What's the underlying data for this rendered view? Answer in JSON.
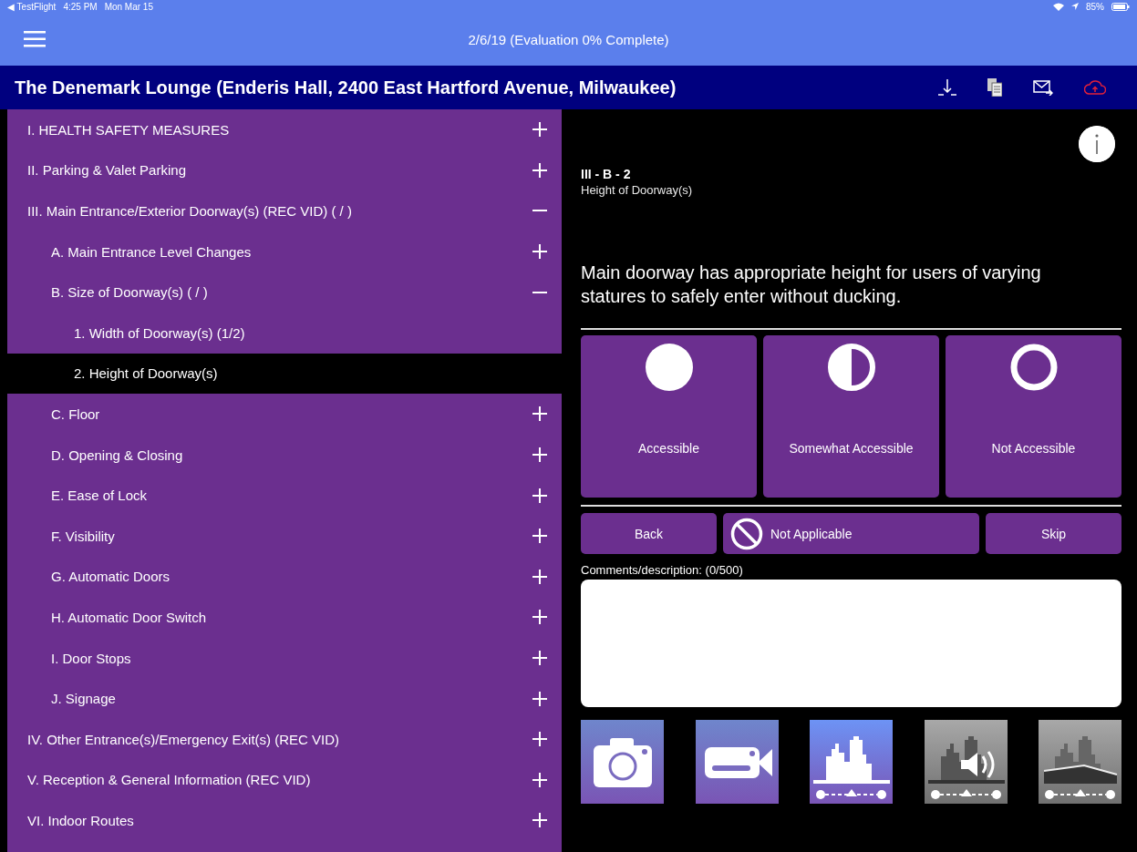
{
  "status_bar": {
    "back_app": "◀ TestFlight",
    "time": "4:25 PM",
    "date": "Mon Mar 15",
    "battery": "85%"
  },
  "nav_bar": {
    "title": "2/6/19 (Evaluation 0% Complete)"
  },
  "header": {
    "title": "The Denemark Lounge (Enderis Hall, 2400 East Hartford Avenue, Milwaukee)"
  },
  "sidebar": {
    "items": [
      {
        "label": "I. HEALTH SAFETY MEASURES",
        "expanded": false,
        "selected": false
      },
      {
        "label": "II. Parking & Valet Parking",
        "expanded": false,
        "selected": false
      },
      {
        "label": "III. Main Entrance/Exterior Doorway(s) (REC VID) ( / )",
        "expanded": true,
        "selected": false,
        "children": [
          {
            "label": "A. Main Entrance Level Changes",
            "expanded": false,
            "selected": false
          },
          {
            "label": "B. Size of Doorway(s) ( / )",
            "expanded": true,
            "selected": false,
            "children": [
              {
                "label": "1. Width of Doorway(s) (1/2)",
                "selected": false
              },
              {
                "label": "2. Height of Doorway(s)",
                "selected": true
              }
            ]
          },
          {
            "label": "C. Floor",
            "expanded": false,
            "selected": false
          },
          {
            "label": "D. Opening & Closing",
            "expanded": false,
            "selected": false
          },
          {
            "label": "E. Ease of Lock",
            "expanded": false,
            "selected": false
          },
          {
            "label": "F. Visibility",
            "expanded": false,
            "selected": false
          },
          {
            "label": "G. Automatic Doors",
            "expanded": false,
            "selected": false
          },
          {
            "label": "H. Automatic Door Switch",
            "expanded": false,
            "selected": false
          },
          {
            "label": "I. Door Stops",
            "expanded": false,
            "selected": false
          },
          {
            "label": "J. Signage",
            "expanded": false,
            "selected": false
          }
        ]
      },
      {
        "label": "IV. Other Entrance(s)/Emergency Exit(s) (REC VID)",
        "expanded": false,
        "selected": false
      },
      {
        "label": "V. Reception & General Information (REC VID)",
        "expanded": false,
        "selected": false
      },
      {
        "label": "VI. Indoor Routes",
        "expanded": false,
        "selected": false
      }
    ]
  },
  "question": {
    "code": "III - B - 2",
    "title": "Height of Doorway(s)",
    "text": "Main doorway has appropriate height for users of varying statures to safely enter without ducking."
  },
  "ratings": [
    {
      "kind": "full",
      "label": "Accessible",
      "selected": false
    },
    {
      "kind": "half",
      "label": "Somewhat Accessible",
      "selected": false
    },
    {
      "kind": "empty",
      "label": "Not Accessible",
      "selected": false
    }
  ],
  "actions": [
    {
      "kind": "back",
      "label": "Back"
    },
    {
      "kind": "na",
      "label": "Not Applicable"
    },
    {
      "kind": "skip",
      "label": "Skip"
    }
  ],
  "comments": {
    "label": "Comments/description: (0/500)"
  },
  "media": [
    {
      "kind": "photo",
      "disabled": false
    },
    {
      "kind": "video",
      "disabled": false
    },
    {
      "kind": "scene",
      "disabled": false
    },
    {
      "kind": "sound",
      "disabled": true
    },
    {
      "kind": "ramp",
      "disabled": true
    }
  ]
}
